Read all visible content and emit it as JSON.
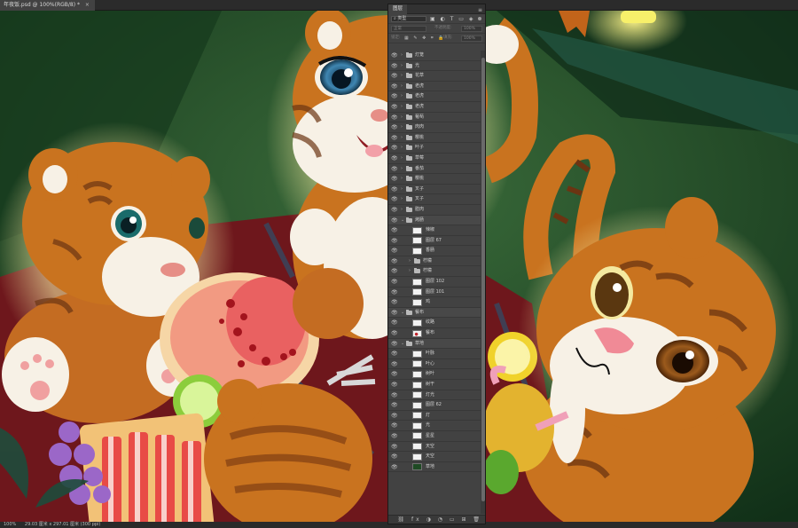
{
  "document": {
    "tab_title": "年夜饭.psd @ 100%(RGB/8) *",
    "close_glyph": "×"
  },
  "status_bar": {
    "zoom": "100%",
    "doc_info": "29.03 厘米 x 297.01 厘米 (300 ppi)"
  },
  "layers_panel": {
    "tab_label": "图层",
    "menu_glyph": "≡",
    "filter_kind": "类型",
    "filter_icons": "▣ ◐ T ▭ ◈",
    "blend_mode": "正常",
    "opacity_label": "不透明度:",
    "opacity_value": "100%",
    "lock_label": "锁定:",
    "lock_icons": "▦ ✎ ✥ ⌗ 🔒",
    "fill_label": "填充:",
    "fill_value": "100%",
    "footer_icons": "⛓ fx ◑ ◔ ▭ ⊞ 🗑",
    "layers": [
      {
        "name": "灯笼",
        "kind": "folder",
        "indent": 0
      },
      {
        "name": "光",
        "kind": "folder",
        "indent": 0
      },
      {
        "name": "花草",
        "kind": "folder",
        "indent": 0
      },
      {
        "name": "老虎",
        "kind": "folder",
        "indent": 0
      },
      {
        "name": "老虎",
        "kind": "folder",
        "indent": 0
      },
      {
        "name": "老虎",
        "kind": "folder",
        "indent": 0
      },
      {
        "name": "葡萄",
        "kind": "folder",
        "indent": 0
      },
      {
        "name": "肉肉",
        "kind": "folder",
        "indent": 0
      },
      {
        "name": "樱桃",
        "kind": "folder",
        "indent": 0
      },
      {
        "name": "叶子",
        "kind": "folder",
        "indent": 0
      },
      {
        "name": "草莓",
        "kind": "folder",
        "indent": 0
      },
      {
        "name": "番茄",
        "kind": "folder",
        "indent": 0
      },
      {
        "name": "樱桃",
        "kind": "folder",
        "indent": 0
      },
      {
        "name": "叉子",
        "kind": "folder",
        "indent": 0
      },
      {
        "name": "叉子",
        "kind": "folder",
        "indent": 0
      },
      {
        "name": "腊肉",
        "kind": "folder",
        "indent": 0
      },
      {
        "name": "烤肠",
        "kind": "folder-open",
        "indent": 0
      },
      {
        "name": "辣椒",
        "kind": "layer",
        "indent": 1
      },
      {
        "name": "图层 67",
        "kind": "layer",
        "indent": 1
      },
      {
        "name": "香肠",
        "kind": "layer",
        "indent": 1
      },
      {
        "name": "柠檬",
        "kind": "folder",
        "indent": 1
      },
      {
        "name": "柠檬",
        "kind": "folder",
        "indent": 1
      },
      {
        "name": "图层 102",
        "kind": "layer",
        "indent": 1
      },
      {
        "name": "图层 101",
        "kind": "layer",
        "indent": 1
      },
      {
        "name": "鸡",
        "kind": "layer",
        "indent": 1
      },
      {
        "name": "餐布",
        "kind": "folder-open",
        "indent": 0
      },
      {
        "name": "纹路",
        "kind": "layer",
        "indent": 1
      },
      {
        "name": "餐布",
        "kind": "layer-red",
        "indent": 1
      },
      {
        "name": "草地",
        "kind": "folder-open",
        "indent": 0
      },
      {
        "name": "叶脉",
        "kind": "layer",
        "indent": 1
      },
      {
        "name": "叶心",
        "kind": "layer",
        "indent": 1
      },
      {
        "name": "树叶",
        "kind": "layer",
        "indent": 1
      },
      {
        "name": "树干",
        "kind": "layer",
        "indent": 1
      },
      {
        "name": "灯光",
        "kind": "layer",
        "indent": 1
      },
      {
        "name": "图层 62",
        "kind": "layer",
        "indent": 1
      },
      {
        "name": "灯",
        "kind": "layer",
        "indent": 1
      },
      {
        "name": "光",
        "kind": "layer",
        "indent": 1
      },
      {
        "name": "星星",
        "kind": "layer",
        "indent": 1
      },
      {
        "name": "天空",
        "kind": "layer",
        "indent": 1
      },
      {
        "name": "天空",
        "kind": "layer",
        "indent": 1
      },
      {
        "name": "草地",
        "kind": "layer-green",
        "indent": 1
      }
    ]
  },
  "colors": {
    "panel_bg": "#424242",
    "canvas_bg": "#1f4a24",
    "fur": "#c9731f",
    "cloth": "#7a1c1f"
  }
}
